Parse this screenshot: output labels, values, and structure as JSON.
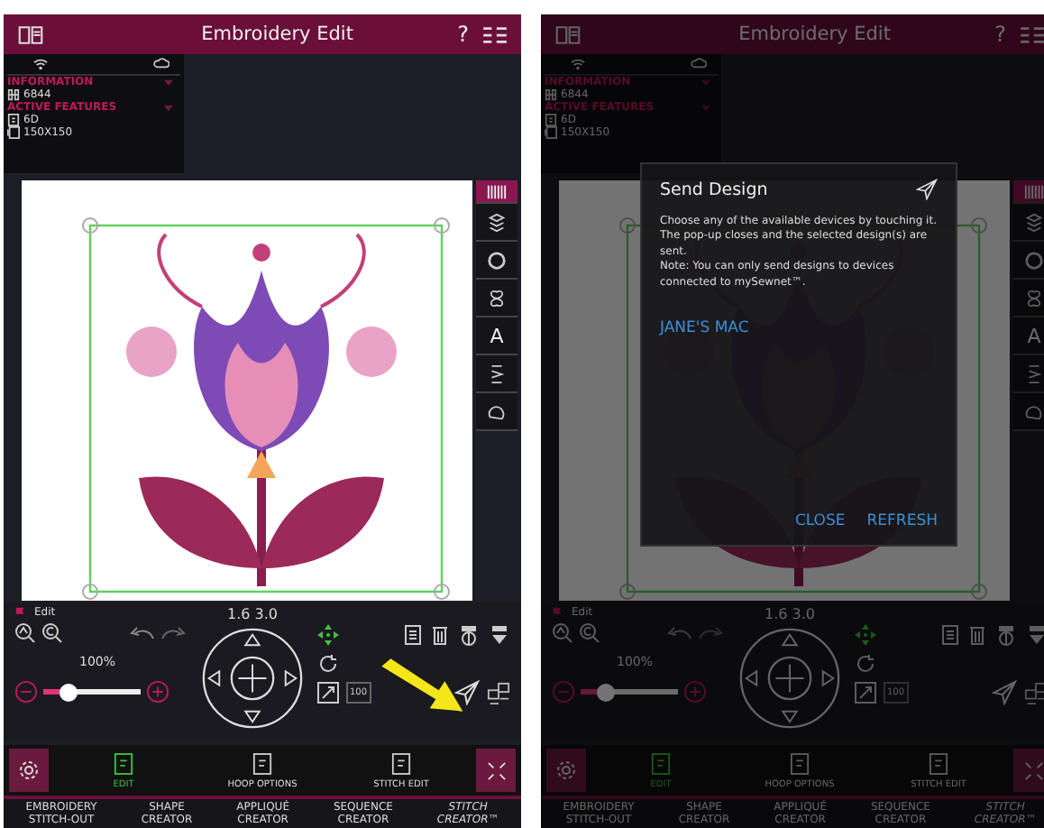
{
  "screens": [
    {
      "title": "Embroidery Edit",
      "help": "?",
      "info_heading": "INFORMATION",
      "stitch_count": "6844",
      "features_heading": "ACTIVE FEATURES",
      "features": [
        "6D",
        "150X150"
      ],
      "sidebar_tools": [
        {
          "selected": true
        },
        {
          "selected": false
        },
        {
          "selected": false
        },
        {
          "selected": false
        },
        {
          "selected": false,
          "label": "A"
        },
        {
          "selected": false
        },
        {
          "selected": false
        }
      ],
      "edit_label": "Edit",
      "dimensions": "1.6 3.0",
      "zoom": "100%",
      "zoom_slider": {
        "level": 0.25
      },
      "scale_box": "100",
      "tabs": [
        {
          "label": "EDIT",
          "selected": true
        },
        {
          "label": "HOOP OPTIONS",
          "selected": false
        },
        {
          "label": "STITCH EDIT",
          "selected": false
        }
      ],
      "nav": [
        {
          "label": "EMBROIDERY STITCH-OUT",
          "italic": false
        },
        {
          "label": "SHAPE CREATOR",
          "italic": false
        },
        {
          "label": "APPLIQUÉ CREATOR",
          "italic": false
        },
        {
          "label": "SEQUENCE CREATOR",
          "italic": false
        },
        {
          "label": "STITCH CREATOR™",
          "italic": true
        }
      ],
      "pointer_arrow": true,
      "dimmed": false
    },
    {
      "title": "Embroidery Edit",
      "help": "?",
      "info_heading": "INFORMATION",
      "stitch_count": "6844",
      "features_heading": "ACTIVE FEATURES",
      "features": [
        "6D",
        "150X150"
      ],
      "sidebar_tools": [
        {
          "selected": true
        },
        {
          "selected": false
        },
        {
          "selected": false
        },
        {
          "selected": false
        },
        {
          "selected": false,
          "label": "A"
        },
        {
          "selected": false
        },
        {
          "selected": false
        }
      ],
      "edit_label": "Edit",
      "dimensions": "1.6 3.0",
      "zoom": "100%",
      "zoom_slider": {
        "level": 0.25
      },
      "scale_box": "100",
      "tabs": [
        {
          "label": "EDIT",
          "selected": true
        },
        {
          "label": "HOOP OPTIONS",
          "selected": false
        },
        {
          "label": "STITCH EDIT",
          "selected": false
        }
      ],
      "nav": [
        {
          "label": "EMBROIDERY STITCH-OUT",
          "italic": false
        },
        {
          "label": "SHAPE CREATOR",
          "italic": false
        },
        {
          "label": "APPLIQUÉ CREATOR",
          "italic": false
        },
        {
          "label": "SEQUENCE CREATOR",
          "italic": false
        },
        {
          "label": "STITCH CREATOR™",
          "italic": true
        }
      ],
      "pointer_arrow": false,
      "dimmed": true,
      "dialog": {
        "title": "Send Design",
        "body": "Choose any of the available devices by touching it. The pop-up closes and the selected design(s) are sent.",
        "note": "Note: You can only send designs to devices connected to mySewnet™.",
        "devices": [
          "JANE'S MAC"
        ],
        "buttons": [
          "CLOSE",
          "REFRESH"
        ]
      }
    }
  ]
}
